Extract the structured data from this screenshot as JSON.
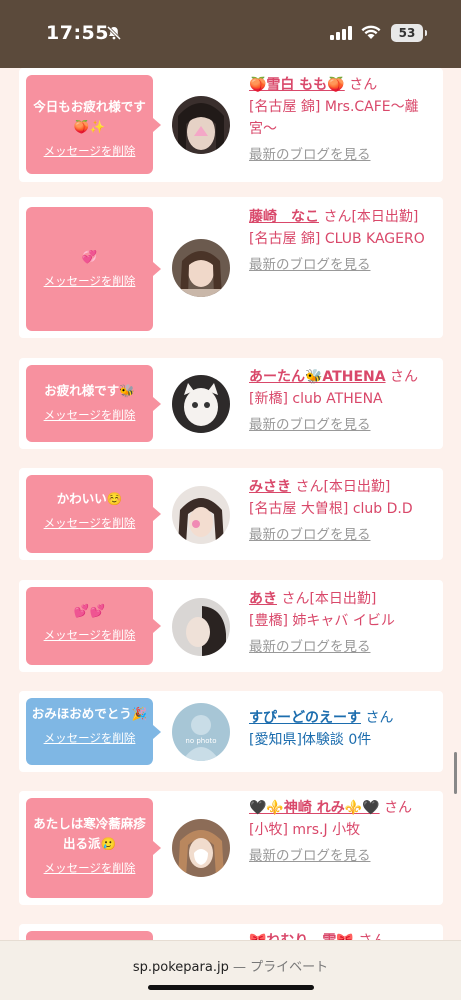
{
  "status_bar": {
    "time": "17:55",
    "battery": "53"
  },
  "cards": [
    {
      "message": "今日もお疲れ様です🍑✨",
      "delete_label": "メッセージを削除",
      "name": "🍑雪白 もも🍑",
      "san": "さん",
      "detail": "[名古屋 錦] Mrs.CAFE〜離宮〜",
      "blog": "最新のブログを見る",
      "bubble_color": "#f7919f"
    },
    {
      "message": "💞",
      "delete_label": "メッセージを削除",
      "name": "藤崎　なこ",
      "san": "さん[本日出勤]",
      "detail": "[名古屋 錦] CLUB KAGERO",
      "blog": "最新のブログを見る",
      "bubble_color": "#f7919f"
    },
    {
      "message": "お疲れ様です🐝",
      "delete_label": "メッセージを削除",
      "name": "あーたん🐝ATHENA",
      "san": "さん",
      "detail": "[新橋] club ATHENA",
      "blog": "最新のブログを見る",
      "bubble_color": "#f7919f"
    },
    {
      "message": "かわいい☺️",
      "delete_label": "メッセージを削除",
      "name": "みさき",
      "san": "さん[本日出勤]",
      "detail": "[名古屋 大曽根] club D.D",
      "blog": "最新のブログを見る",
      "bubble_color": "#f7919f"
    },
    {
      "message": "💕💕",
      "delete_label": "メッセージを削除",
      "name": "あき",
      "san": "さん[本日出勤]",
      "detail": "[豊橋] 姉キャバ イビル",
      "blog": "最新のブログを見る",
      "bubble_color": "#f7919f"
    },
    {
      "message": "おみほおめでとう🎉",
      "delete_label": "メッセージを削除",
      "name": "すぴーどのえーす",
      "san": "さん",
      "detail": "[愛知県]体験談 0件",
      "blog": "",
      "bubble_color": "#7fb7e4",
      "avatar_text": "no photo"
    },
    {
      "message": "あたしは寒冷蕎麻疹出る派🥲",
      "delete_label": "メッセージを削除",
      "name": "🖤⚜️神崎 れみ⚜️🖤",
      "san": "さん",
      "detail": "[小牧] mrs.J 小牧",
      "blog": "最新のブログを見る",
      "bubble_color": "#f7919f"
    },
    {
      "message": "",
      "delete_label": "",
      "name": "🎀ねむり…雫🎀",
      "san": "さん",
      "detail": "",
      "blog": "",
      "bubble_color": "#f7919f"
    }
  ],
  "url_bar": {
    "domain": "sp.pokepara.jp",
    "separator": "—",
    "mode": "プライベート"
  }
}
